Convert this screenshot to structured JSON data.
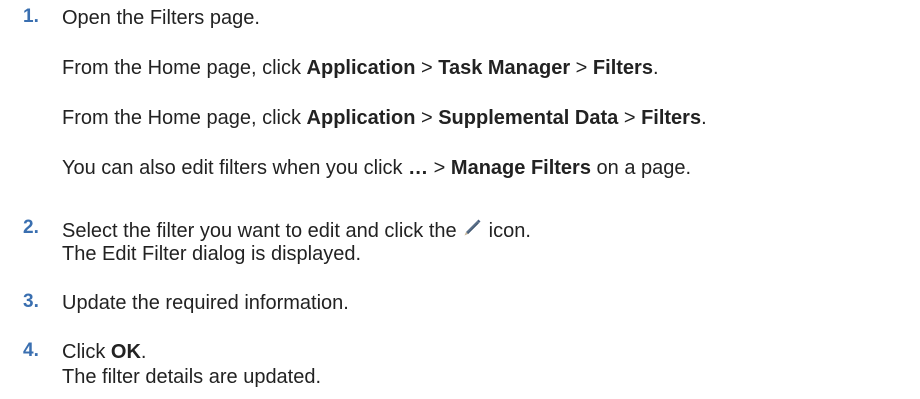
{
  "steps": [
    {
      "number": "1.",
      "lines": [
        {
          "text": "Open the Filters page."
        },
        {
          "p1": "From the Home page, click ",
          "b1": "Application",
          "s1": " > ",
          "b2": "Task Manager",
          "s2": " > ",
          "b3": "Filters",
          "end": "."
        },
        {
          "p1": "From the Home page, click ",
          "b1": "Application",
          "s1": " > ",
          "b2": "Supplemental Data",
          "s2": " > ",
          "b3": "Filters",
          "end": "."
        },
        {
          "p1": "You can also edit filters when you click ",
          "b1": "…",
          "s1": " > ",
          "b2": "Manage Filters",
          "end": " on a page."
        }
      ]
    },
    {
      "number": "2.",
      "lines": [
        {
          "before": "Select the filter you want to edit and click the",
          "after": "icon.",
          "icon": "pencil-edit-icon"
        },
        {
          "text": "The Edit Filter dialog is displayed."
        }
      ]
    },
    {
      "number": "3.",
      "lines": [
        {
          "text": "Update the required information."
        }
      ]
    },
    {
      "number": "4.",
      "lines": [
        {
          "p1": "Click ",
          "b1": "OK",
          "end": "."
        },
        {
          "text": "The filter details are updated."
        }
      ]
    }
  ]
}
